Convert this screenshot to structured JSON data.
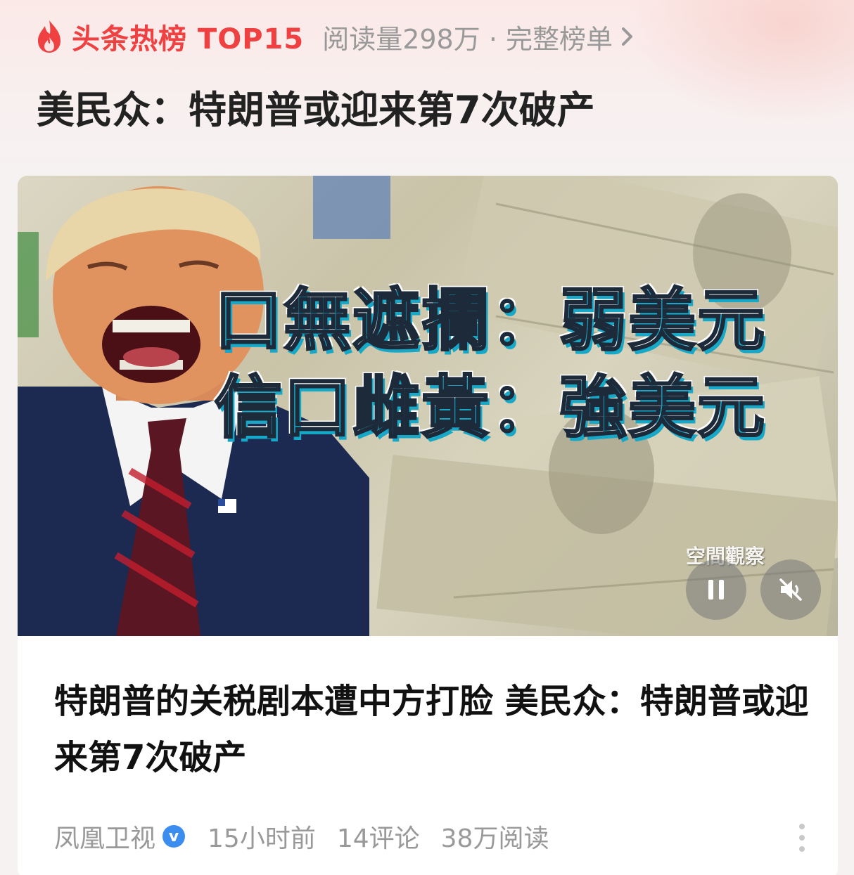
{
  "header": {
    "hot_label": "头条热榜 TOP15",
    "meta_text": "阅读量298万 · 完整榜单",
    "headline": "美民众：特朗普或迎来第7次破产"
  },
  "media": {
    "overlay_line1": "口無遮攔：弱美元",
    "overlay_line2": "信口雌黃：強美元",
    "watermark": "空間觀察",
    "pause_icon": "pause-icon",
    "mute_icon": "mute-icon"
  },
  "article": {
    "title": "特朗普的关税剧本遭中方打脸 美民众：特朗普或迎来第7次破产",
    "source": "凤凰卫视",
    "verified_mark": "v",
    "time": "15小时前",
    "comments": "14评论",
    "reads": "38万阅读"
  },
  "colors": {
    "accent": "#f04142",
    "meta_gray": "#999999",
    "verified_blue": "#3c8df0"
  }
}
